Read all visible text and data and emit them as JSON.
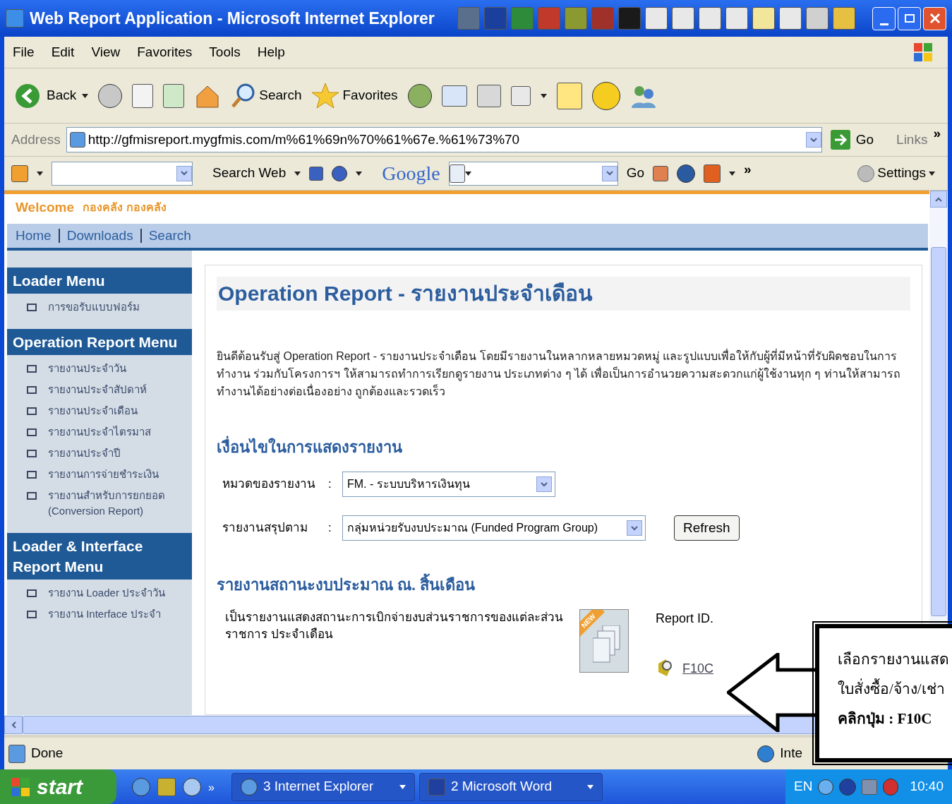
{
  "window": {
    "title": "Web Report Application - Microsoft Internet Explorer"
  },
  "menu_bar": [
    "File",
    "Edit",
    "View",
    "Favorites",
    "Tools",
    "Help"
  ],
  "toolbar": {
    "back": "Back",
    "search": "Search",
    "favorites": "Favorites"
  },
  "address_bar": {
    "label": "Address",
    "url": "http://gfmisreport.mygfmis.com/m%61%69n%70%61%67e.%61%73%70",
    "go": "Go",
    "links": "Links",
    "more": "»"
  },
  "google_bar": {
    "search_web": "Search Web",
    "logo": "Google",
    "go": "Go",
    "more": "»",
    "settings": "Settings"
  },
  "page": {
    "welcome": "Welcome",
    "user": "กองคลัง กองคลัง",
    "nav": [
      "Home",
      "Downloads",
      "Search"
    ],
    "sidebar": [
      {
        "title": "Loader Menu",
        "items": [
          "การขอรับแบบฟอร์ม"
        ]
      },
      {
        "title": "Operation Report Menu",
        "items": [
          "รายงานประจำวัน",
          "รายงานประจำสัปดาห์",
          "รายงานประจำเดือน",
          "รายงานประจำไตรมาส",
          "รายงานประจำปี",
          "รายงานการจ่ายชำระเงิน",
          "รายงานสำหรับการยกยอด (Conversion Report)"
        ]
      },
      {
        "title": "Loader & Interface Report Menu",
        "items": [
          "รายงาน Loader ประจำวัน",
          "รายงาน Interface ประจำ"
        ]
      }
    ],
    "heading": "Operation Report -  รายงานประจำเดือน",
    "intro": "ยินดีต้อนรับสู่ Operation Report - รายงานประจำเดือน  โดยมีรายงานในหลากหลายหมวดหมู่ และรูปแบบเพื่อให้กับผู้ที่มีหน้าที่รับผิดชอบในการทำงาน ร่วมกับโครงการฯ ให้สามารถทำการเรียกดูรายงาน ประเภทต่าง ๆ ได้ เพื่อเป็นการอำนวยความสะดวกแก่ผู้ใช้งานทุก ๆ ท่านให้สามารถทำงานได้อย่างต่อเนื่องอย่าง ถูกต้องและรวดเร็ว",
    "conditions_heading": "เงื่อนไขในการแสดงรายงาน",
    "fields": [
      {
        "label": "หมวดของรายงาน",
        "colon": ":",
        "value": "FM. - ระบบบริหารเงินทุน"
      },
      {
        "label": "รายงานสรุปตาม",
        "colon": ":",
        "value": "กลุ่มหน่วยรับงบประมาณ (Funded Program Group)"
      }
    ],
    "refresh": "Refresh",
    "report_heading": "รายงานสถานะงบประมาณ ณ. สิ้นเดือน",
    "report_description": "เป็นรายงานแสดงสถานะการเบิกจ่ายงบส่วนราชการของแต่ละส่วนราชการ ประจำเดือน",
    "new_badge": "NEW",
    "report_id_label": "Report ID.",
    "report_link": "F10C"
  },
  "callout": [
    "เลือกรายงานแสด",
    "ใบสั่งซื้อ/จ้าง/เช่า",
    "คลิกปุ่ม : F10C"
  ],
  "status_bar": {
    "text": "Done",
    "zone": "Inte"
  },
  "taskbar": {
    "start": "start",
    "more": "»",
    "tasks": [
      "3 Internet Explorer",
      "2 Microsoft Word"
    ],
    "language": "EN",
    "clock": "10:40"
  }
}
